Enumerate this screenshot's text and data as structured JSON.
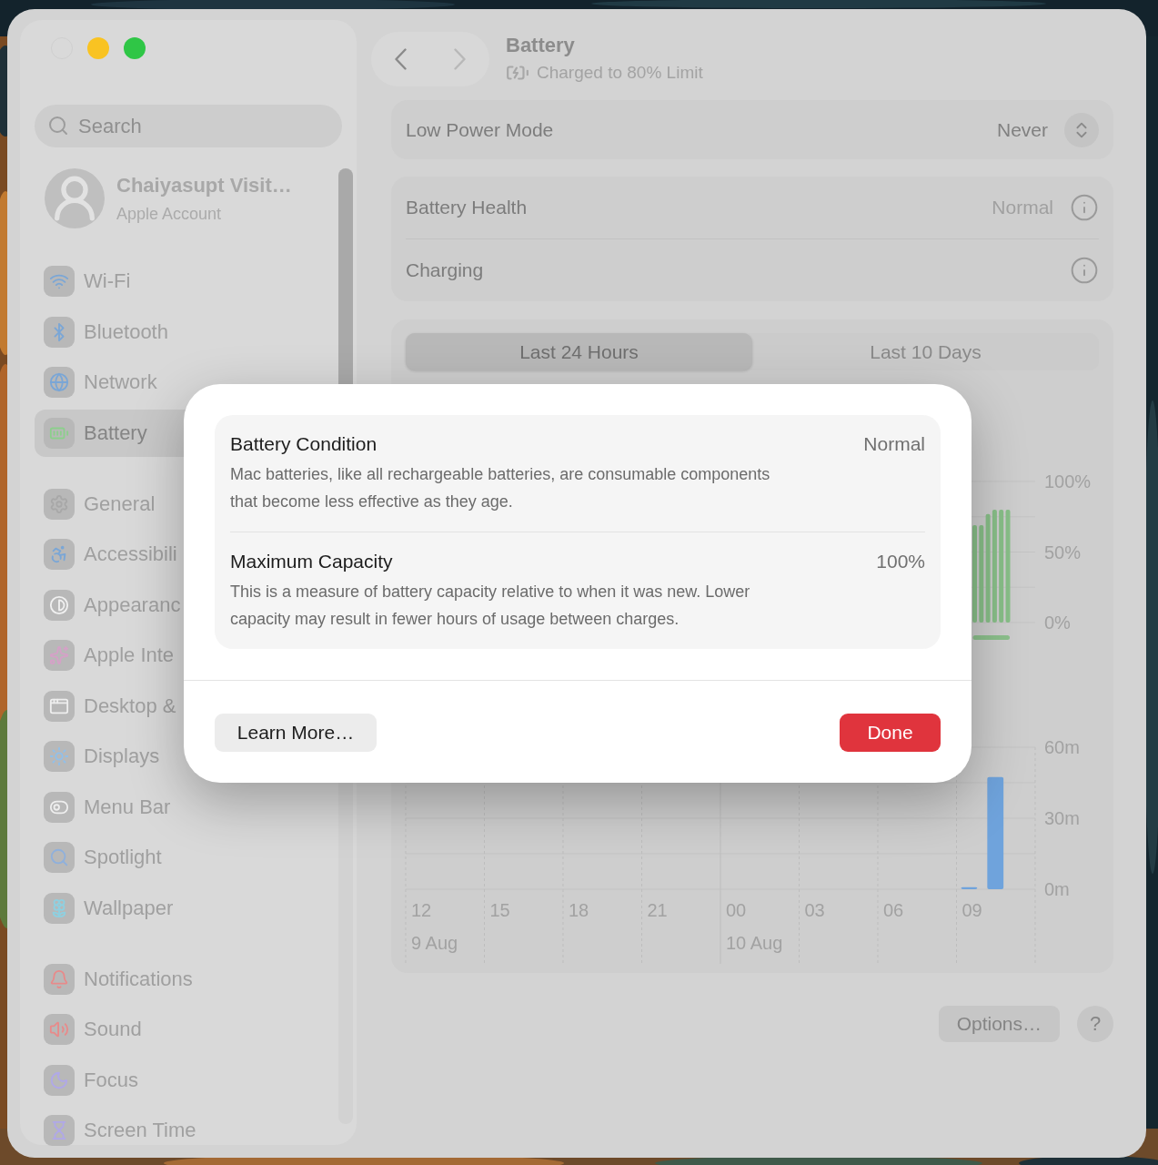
{
  "window": {
    "traffic_lights": [
      {
        "kind": "close"
      },
      {
        "kind": "minimize"
      },
      {
        "kind": "zoom"
      }
    ]
  },
  "sidebar": {
    "search": {
      "placeholder": "Search"
    },
    "account": {
      "name": "Chaiyasupt Visit…",
      "subtitle": "Apple Account"
    },
    "groups": [
      {
        "items": [
          {
            "label": "Wi-Fi",
            "kind": "wifi",
            "selected": false
          },
          {
            "label": "Bluetooth",
            "kind": "bluetooth",
            "selected": false
          },
          {
            "label": "Network",
            "kind": "network",
            "selected": false
          },
          {
            "label": "Battery",
            "kind": "battery",
            "selected": true
          }
        ]
      },
      {
        "items": [
          {
            "label": "General",
            "kind": "general",
            "selected": false
          },
          {
            "label": "Accessibili",
            "kind": "accessibility",
            "selected": false
          },
          {
            "label": "Appearanc",
            "kind": "appearance",
            "selected": false
          },
          {
            "label": "Apple Inte",
            "kind": "intelligence",
            "selected": false
          },
          {
            "label": "Desktop &",
            "kind": "desktop",
            "selected": false
          },
          {
            "label": "Displays",
            "kind": "displays",
            "selected": false
          },
          {
            "label": "Menu Bar",
            "kind": "menubar",
            "selected": false
          },
          {
            "label": "Spotlight",
            "kind": "spotlight",
            "selected": false
          },
          {
            "label": "Wallpaper",
            "kind": "wallpaper",
            "selected": false
          }
        ]
      },
      {
        "items": [
          {
            "label": "Notifications",
            "kind": "notifications",
            "selected": false
          },
          {
            "label": "Sound",
            "kind": "sound",
            "selected": false
          },
          {
            "label": "Focus",
            "kind": "focus",
            "selected": false
          },
          {
            "label": "Screen Time",
            "kind": "screentime",
            "selected": false
          }
        ]
      }
    ]
  },
  "header": {
    "nav": [
      {
        "kind": "back",
        "disabled": false
      },
      {
        "kind": "forward",
        "disabled": true
      }
    ],
    "title": "Battery",
    "subtitle": "Charged to 80% Limit"
  },
  "low_power_mode": {
    "label": "Low Power Mode",
    "value": "Never"
  },
  "health_rows": [
    {
      "label": "Battery Health",
      "value": "Normal"
    },
    {
      "label": "Charging"
    }
  ],
  "usage": {
    "tabs": [
      {
        "label": "Last 24 Hours",
        "selected": true
      },
      {
        "label": "Last 10 Days",
        "selected": false
      }
    ],
    "level_chart": {
      "axis_labels": [
        "100%",
        "50%",
        "0%"
      ]
    },
    "activity_chart": {
      "chart_data": {
        "type": "bar",
        "categories": [
          "12",
          null,
          null,
          "15",
          null,
          null,
          "18",
          null,
          null,
          "21",
          null,
          null,
          "00",
          null,
          null,
          "03",
          null,
          null,
          "06",
          null,
          null,
          "09",
          null,
          null
        ],
        "values": [
          0,
          0,
          0,
          0,
          0,
          0,
          0,
          0,
          0,
          0,
          0,
          0,
          0,
          0,
          0,
          0,
          0,
          0,
          0,
          0,
          0,
          0.5,
          47,
          0
        ],
        "ylim": [
          0,
          60
        ],
        "yticks": [
          {
            "value": 0,
            "label": "0m"
          },
          {
            "value": 30,
            "label": "30m"
          },
          {
            "value": 60,
            "label": "60m"
          }
        ]
      },
      "date_labels": [
        "9 Aug",
        "10 Aug"
      ]
    }
  },
  "footer_buttons": [
    {
      "kind": "options",
      "label": "Options…"
    },
    {
      "kind": "help",
      "label": "?"
    }
  ],
  "dialog": {
    "sections": [
      {
        "title": "Battery Condition",
        "value": "Normal",
        "description": "Mac batteries, like all rechargeable batteries, are consumable components that become less effective as they age."
      },
      {
        "title": "Maximum Capacity",
        "value": "100%",
        "description": "This is a measure of battery capacity relative to when it was new. Lower capacity may result in fewer hours of usage between charges."
      }
    ],
    "buttons": [
      {
        "label": "Learn More…",
        "kind": "secondary"
      },
      {
        "label": "Done",
        "kind": "primary"
      }
    ]
  }
}
